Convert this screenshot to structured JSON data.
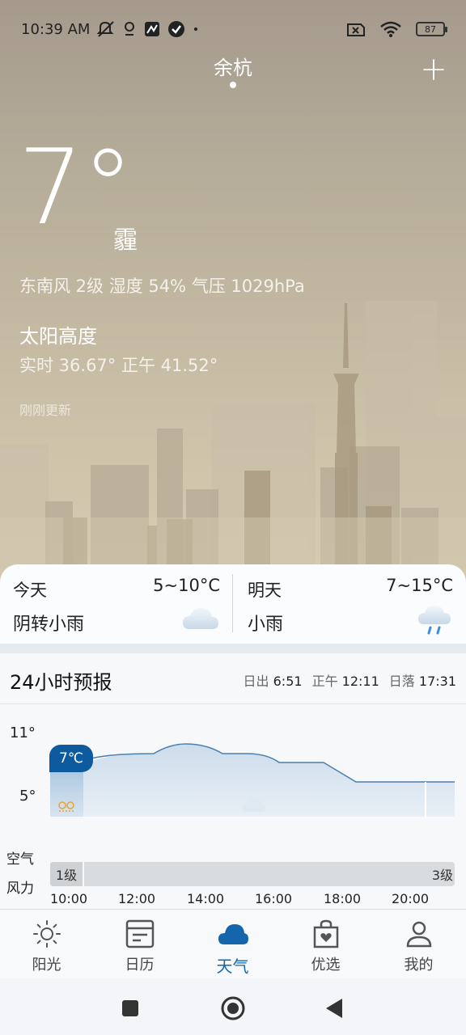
{
  "status": {
    "time": "10:39 AM",
    "battery": "87"
  },
  "header": {
    "city": "余杭",
    "add_label": "+"
  },
  "current": {
    "temperature": "7°",
    "condition": "霾",
    "details": "东南风 2级 湿度 54% 气压 1029hPa",
    "sun_title": "太阳高度",
    "sun_values": "实时 36.67° 正午 41.52°",
    "updated": "刚刚更新"
  },
  "today": {
    "label": "今天",
    "range": "5~10°C",
    "desc": "阴转小雨",
    "icon": "cloud-icon"
  },
  "tomorrow": {
    "label": "明天",
    "range": "7~15°C",
    "desc": "小雨",
    "icon": "rain-icon"
  },
  "forecast": {
    "title": "24小时预报",
    "sunrise_label": "日出",
    "sunrise": "6:51",
    "noon_label": "正午",
    "noon": "12:11",
    "sunset_label": "日落",
    "sunset": "17:31",
    "y_max": "11°",
    "y_min": "5°",
    "now_tag": "7℃",
    "air_label": "空气",
    "wind_label": "风力",
    "wind_start": "1级",
    "wind_end": "3级",
    "hours": [
      "10:00",
      "12:00",
      "14:00",
      "16:00",
      "18:00",
      "20:00"
    ]
  },
  "nav": {
    "items": [
      {
        "label": "阳光",
        "icon": "sun-icon"
      },
      {
        "label": "日历",
        "icon": "calendar-icon"
      },
      {
        "label": "天气",
        "icon": "weather-cloud-icon"
      },
      {
        "label": "优选",
        "icon": "shopping-bag-icon"
      },
      {
        "label": "我的",
        "icon": "person-icon"
      }
    ],
    "active_color": "#1565ad"
  }
}
